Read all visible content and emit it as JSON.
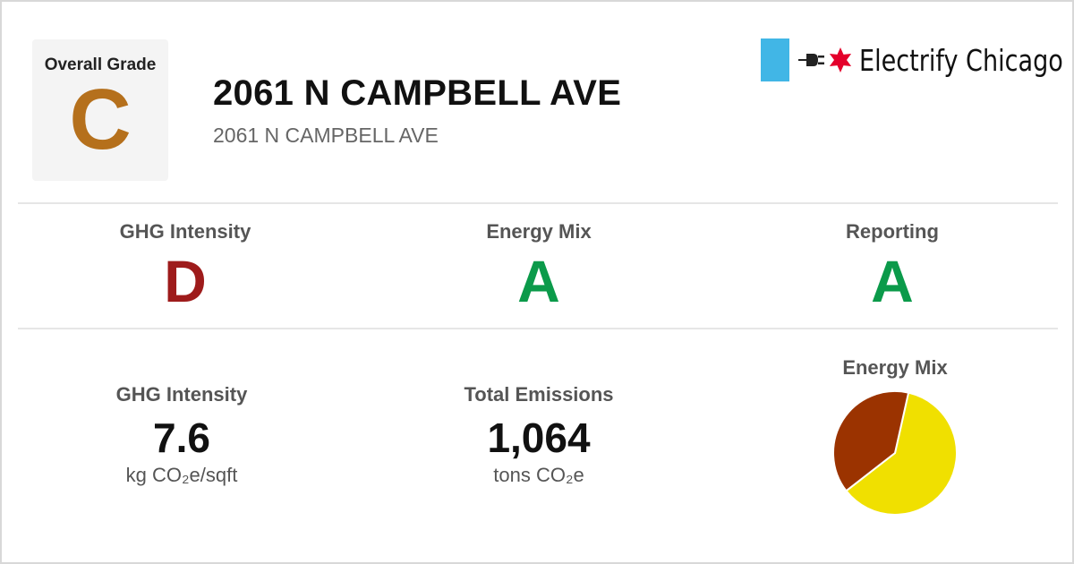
{
  "header": {
    "overall_label": "Overall Grade",
    "overall_grade": "C",
    "overall_color": "#b5701c",
    "title": "2061 N CAMPBELL AVE",
    "subtitle": "2061 N CAMPBELL AVE"
  },
  "logo": {
    "text": "Electrify Chicago",
    "square_color": "#41b6e6",
    "star_color": "#e4002b"
  },
  "grades": [
    {
      "label": "GHG Intensity",
      "grade": "D",
      "color": "#9e1b1b"
    },
    {
      "label": "Energy Mix",
      "grade": "A",
      "color": "#0b9a4a"
    },
    {
      "label": "Reporting",
      "grade": "A",
      "color": "#0b9a4a"
    }
  ],
  "stats": {
    "ghg": {
      "label": "GHG Intensity",
      "value": "7.6",
      "unit": "kg CO₂e/sqft"
    },
    "emissions": {
      "label": "Total Emissions",
      "value": "1,064",
      "unit": "tons CO₂e"
    },
    "mix_label": "Energy Mix"
  },
  "chart_data": {
    "type": "pie",
    "title": "",
    "slices": [
      {
        "value": 61,
        "color": "#f0e000"
      },
      {
        "value": 39,
        "color": "#9b3300"
      }
    ]
  }
}
